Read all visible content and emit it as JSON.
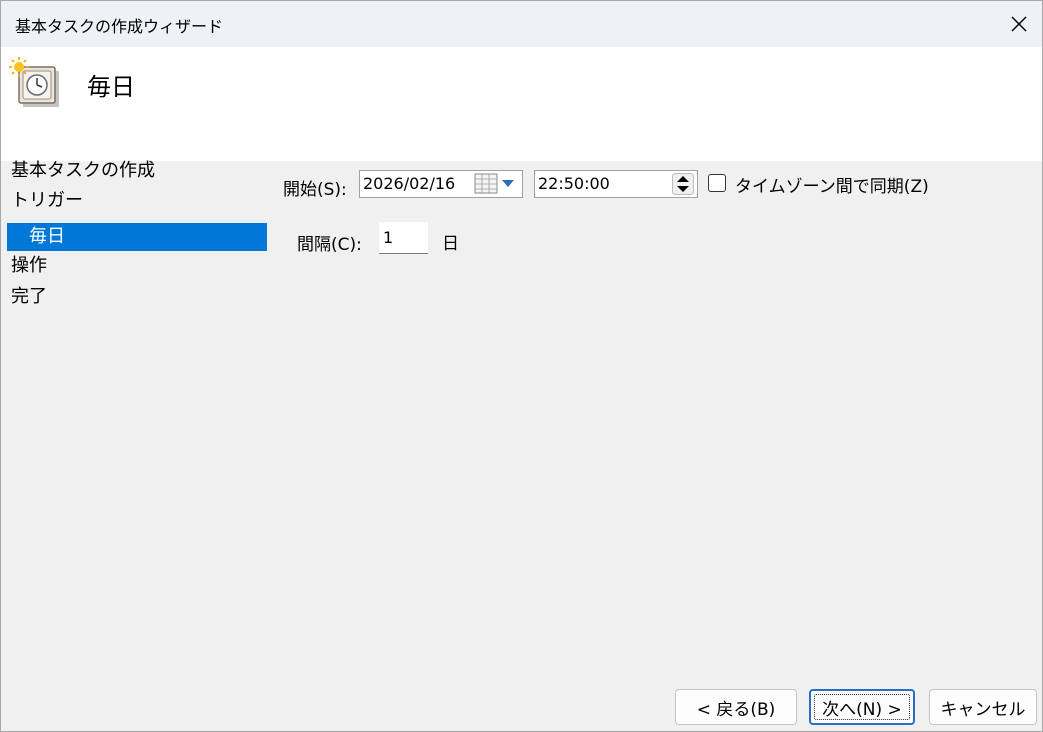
{
  "window": {
    "title": "基本タスクの作成ウィザード"
  },
  "header": {
    "title": "毎日",
    "icon": "scheduled-clock-icon"
  },
  "nav": {
    "items": [
      {
        "label": "基本タスクの作成"
      },
      {
        "label": "トリガー"
      },
      {
        "label": "毎日"
      },
      {
        "label": "操作"
      },
      {
        "label": "完了"
      }
    ],
    "selected": "毎日"
  },
  "form": {
    "start_label": "開始(S):",
    "start_date": "2026/02/16",
    "start_time": "22:50:00",
    "timezone_sync_label": "タイムゾーン間で同期(Z)",
    "timezone_sync_checked": false,
    "interval_label": "間隔(C):",
    "interval_value": "1",
    "interval_unit": "日"
  },
  "buttons": {
    "back": "< 戻る(B)",
    "next": "次へ(N) >",
    "cancel": "キャンセル"
  },
  "colors": {
    "selection": "#0078d7",
    "titlebar": "#eef1f5",
    "header": "#ffffff",
    "body": "#f0f0f0",
    "default_button_border": "#2b6fc4"
  }
}
